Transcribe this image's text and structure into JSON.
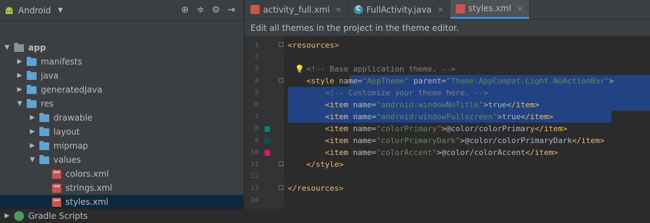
{
  "project_panel": {
    "view_label": "Android",
    "tree": [
      {
        "label": "app",
        "depth": 0,
        "expanded": true,
        "icon": "folder-icon",
        "bold": true
      },
      {
        "label": "manifests",
        "depth": 1,
        "expanded": false,
        "icon": "folder-icon"
      },
      {
        "label": "java",
        "depth": 1,
        "expanded": false,
        "icon": "folder-icon"
      },
      {
        "label": "generatedJava",
        "depth": 1,
        "expanded": false,
        "icon": "folder-icon"
      },
      {
        "label": "res",
        "depth": 1,
        "expanded": true,
        "icon": "folder-icon"
      },
      {
        "label": "drawable",
        "depth": 2,
        "expanded": false,
        "icon": "folder-icon"
      },
      {
        "label": "layout",
        "depth": 2,
        "expanded": false,
        "icon": "folder-icon"
      },
      {
        "label": "mipmap",
        "depth": 2,
        "expanded": false,
        "icon": "folder-icon"
      },
      {
        "label": "values",
        "depth": 2,
        "expanded": true,
        "icon": "folder-icon"
      },
      {
        "label": "colors.xml",
        "depth": 3,
        "icon": "xml-file-icon"
      },
      {
        "label": "strings.xml",
        "depth": 3,
        "icon": "xml-file-icon"
      },
      {
        "label": "styles.xml",
        "depth": 3,
        "icon": "xml-file-icon",
        "selected": true
      },
      {
        "label": "Gradle Scripts",
        "depth": 0,
        "expanded": false,
        "icon": "gradle-icon"
      }
    ]
  },
  "tabs": [
    {
      "label": "activity_full.xml",
      "icon": "xml-file-icon",
      "active": false
    },
    {
      "label": "FullActivity.java",
      "icon": "java-class-icon",
      "active": false
    },
    {
      "label": "styles.xml",
      "icon": "xml-file-icon",
      "active": true
    }
  ],
  "banner": "Edit all themes in the project in the theme editor.",
  "colors": {
    "colorPrimary": "#008577",
    "colorPrimaryDark": "#00574B",
    "colorAccent": "#D81B60"
  },
  "code_lines": [
    {
      "n": "1",
      "text": "<resources>"
    },
    {
      "n": "2",
      "text": ""
    },
    {
      "n": "3",
      "text": "    <!-- Base application theme. -->"
    },
    {
      "n": "4",
      "text": "    <style name=\"AppTheme\" parent=\"Theme.AppCompat.Light.NoActionBar\">"
    },
    {
      "n": "5",
      "text": "        <!-- Customize your theme here. -->"
    },
    {
      "n": "6",
      "text": "        <item name=\"android:windowNoTitle\">true</item>"
    },
    {
      "n": "7",
      "text": "        <item name=\"android:windowFullscreen\">true</item>"
    },
    {
      "n": "8",
      "text": "        <item name=\"colorPrimary\">@color/colorPrimary</item>"
    },
    {
      "n": "9",
      "text": "        <item name=\"colorPrimaryDark\">@color/colorPrimaryDark</item>"
    },
    {
      "n": "10",
      "text": "        <item name=\"colorAccent\">@color/colorAccent</item>"
    },
    {
      "n": "11",
      "text": "    </style>"
    },
    {
      "n": "12",
      "text": ""
    },
    {
      "n": "13",
      "text": "</resources>"
    },
    {
      "n": "14",
      "text": ""
    }
  ]
}
